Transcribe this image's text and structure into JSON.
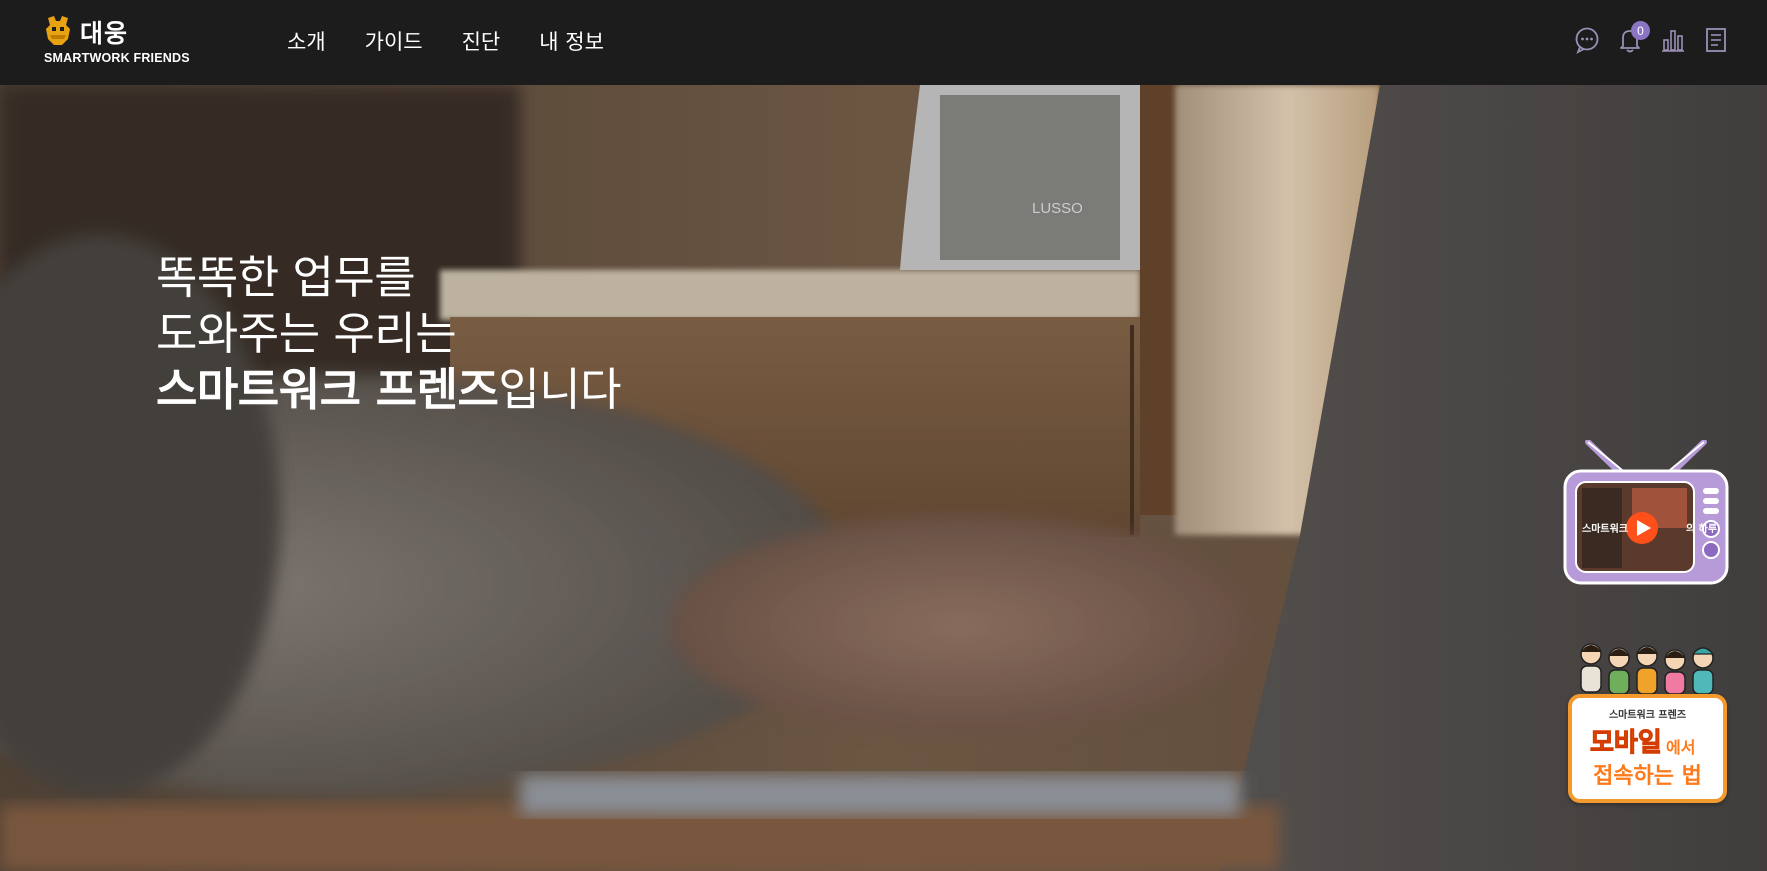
{
  "brand": {
    "name": "대웅",
    "subtitle": "SMARTWORK FRIENDS"
  },
  "nav": {
    "items": [
      "소개",
      "가이드",
      "진단",
      "내 정보"
    ]
  },
  "toolbar": {
    "icons": [
      "chat-icon",
      "bell-icon",
      "bar-chart-icon",
      "document-icon"
    ],
    "notification_count": "0",
    "accent_color": "#8c74c4"
  },
  "hero": {
    "line1": "똑똑한 업무를",
    "line2": "도와주는 우리는",
    "line3_bold": "스마트워크 프렌즈",
    "line3_rest": "입니다"
  },
  "tv_widget": {
    "caption": "스마트워크",
    "caption_end": "의 하루"
  },
  "mobile_widget": {
    "subtitle": "스마트워크 프렌즈",
    "highlight": "모바일",
    "suffix": "에서",
    "line2": "접속하는 법",
    "accent_color": "#f29a2e"
  }
}
